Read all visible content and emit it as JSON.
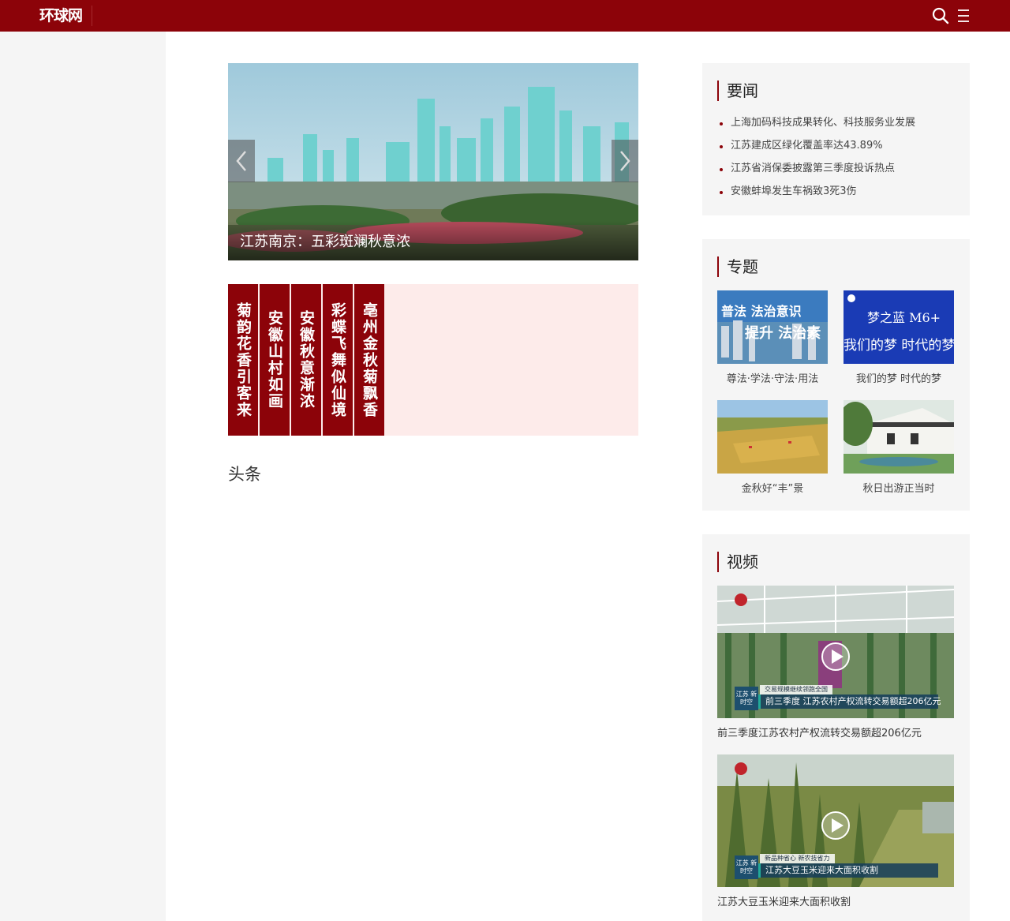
{
  "header": {
    "logo": "环球网",
    "search_icon": "search-icon",
    "menu_icon": "menu-icon"
  },
  "colors": {
    "brand": "#8c0309",
    "band_bg": "#fdebea",
    "panel_bg": "#f5f5f5"
  },
  "slider": {
    "caption": "江苏南京：五彩斑斓秋意浓",
    "prev_icon": "chevron-left-icon",
    "next_icon": "chevron-right-icon"
  },
  "vertical_titles": [
    "菊韵花香引客来",
    "安徽山村如画",
    "安徽秋意渐浓",
    "彩蝶飞舞似仙境",
    "亳州金秋菊飘香"
  ],
  "headline_section": {
    "title": "头条"
  },
  "important_news": {
    "title": "要闻",
    "items": [
      "上海加码科技成果转化、科技服务业发展",
      "江苏建成区绿化覆盖率达43.89%",
      "江苏省消保委披露第三季度投诉热点",
      "安徽蚌埠发生车祸致3死3伤"
    ]
  },
  "topics": {
    "title": "专题",
    "items": [
      {
        "label": "尊法·学法·守法·用法",
        "overlay": "普法 法治意识 提升 法治素"
      },
      {
        "label": "我们的梦 时代的梦",
        "overlay": "梦之蓝 M6+ 我们的梦 时代的梦"
      },
      {
        "label": "金秋好“丰”景"
      },
      {
        "label": "秋日出游正当时"
      }
    ]
  },
  "videos": {
    "title": "视频",
    "items": [
      {
        "label": "前三季度江苏农村产权流转交易额超206亿元",
        "tag_small": "交易规模继续领跑全国",
        "tag_main": "前三季度 江苏农村产权流转交易额超206亿元",
        "badge": "江苏 新时空"
      },
      {
        "label": "江苏大豆玉米迎来大面积收割",
        "tag_small": "新品种省心 新农技省力",
        "tag_main": "江苏大豆玉米迎来大面积收割",
        "badge": "江苏 新时空"
      }
    ]
  }
}
